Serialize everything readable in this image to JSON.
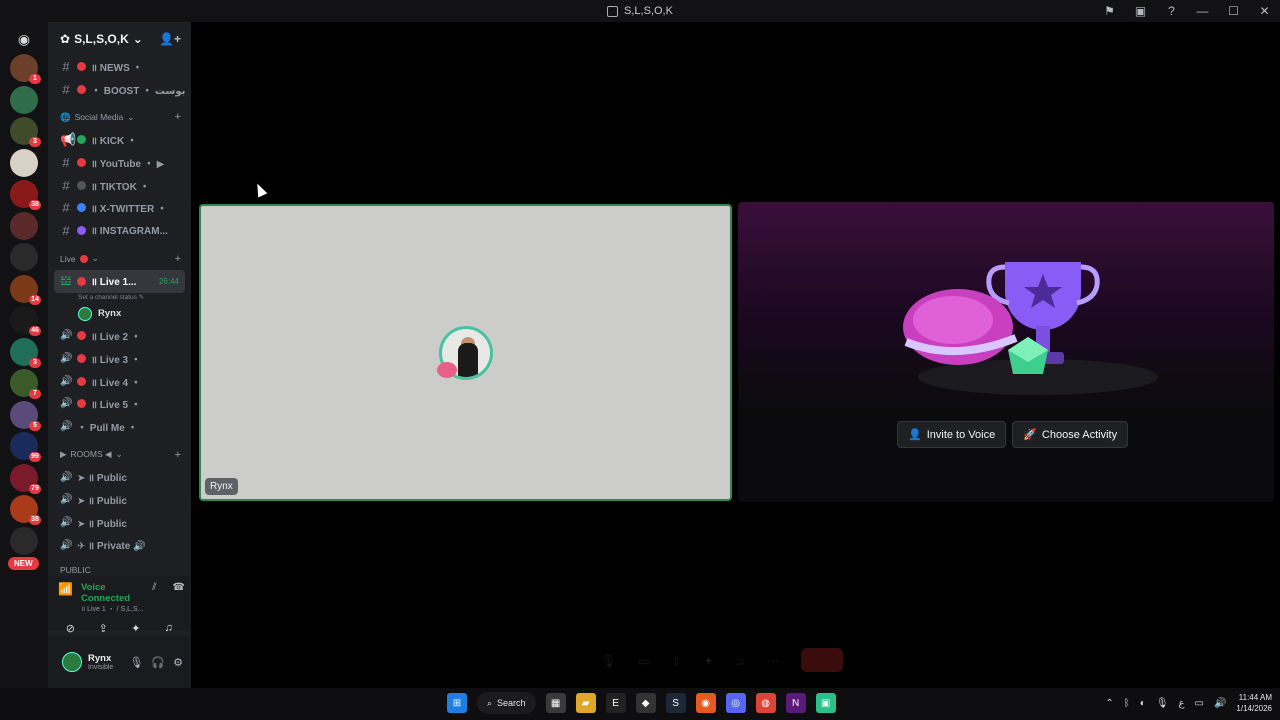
{
  "window": {
    "title": "S,L,S,O,K"
  },
  "guild": {
    "name": "S,L,S,O,K"
  },
  "channels": [
    {
      "prefix": "#",
      "dot": "#e63a42",
      "label": "॥ NEWS ・",
      "type": "text"
    },
    {
      "prefix": "#",
      "dot": "#e63a42",
      "label": "・ BOOST ・ بوست",
      "type": "text"
    }
  ],
  "social_category": {
    "label": "Social Media"
  },
  "social_channels": [
    {
      "prefix": "📢",
      "dot": "#23a55a",
      "label": "॥ KICK ・",
      "type": "announce"
    },
    {
      "prefix": "#",
      "dot": "#e63a42",
      "label": "॥ YouTube ・ ▶",
      "type": "text"
    },
    {
      "prefix": "#",
      "dot": "#555555",
      "label": "॥ TIKTOK ・",
      "type": "text"
    },
    {
      "prefix": "#",
      "dot": "#3b82f6",
      "label": "॥ X-TWITTER ・",
      "type": "text"
    },
    {
      "prefix": "#",
      "dot": "#8b5cf6",
      "label": "॥ INSTAGRAM...",
      "type": "text"
    }
  ],
  "live_category": {
    "label": "Live"
  },
  "live_active": {
    "label": "॥ Live 1...",
    "time": "26:44",
    "status": "Set a channel status"
  },
  "live_member": {
    "name": "Rynx"
  },
  "live_channels": [
    {
      "label": "॥ Live 2 ・"
    },
    {
      "label": "॥ Live 3 ・"
    },
    {
      "label": "॥ Live 4 ・"
    },
    {
      "label": "॥ Live 5 ・"
    },
    {
      "label": "・ Pull Me ・"
    }
  ],
  "rooms_category": {
    "label": "ROOMS ◀"
  },
  "rooms_channels": [
    {
      "label": "➤ ॥ Public"
    },
    {
      "label": "➤ ॥ Public"
    },
    {
      "label": "➤ ॥ Public"
    },
    {
      "label": "✈ ॥ Private 🔊"
    }
  ],
  "public_category": {
    "label": "PUBLIC"
  },
  "servers": [
    {
      "color": "#6b3f2a",
      "badge": "1"
    },
    {
      "color": "#2f6d4a",
      "badge": ""
    },
    {
      "color": "#3f4b2a",
      "badge": "3"
    },
    {
      "color": "#d8d2c6",
      "badge": ""
    },
    {
      "color": "#8a1a1a",
      "badge": "38"
    },
    {
      "color": "#5a2a2a",
      "badge": ""
    },
    {
      "color": "#2a2a2a",
      "badge": ""
    },
    {
      "color": "#7a3a1a",
      "badge": "14"
    },
    {
      "color": "#1a1a1a",
      "badge": "46"
    },
    {
      "color": "#1f6e5a",
      "badge": "3"
    },
    {
      "color": "#3a5a2a",
      "badge": "7"
    },
    {
      "color": "#5a4a7a",
      "badge": "5"
    },
    {
      "color": "#1a2a5a",
      "badge": "99"
    },
    {
      "color": "#7a1a2a",
      "badge": "79"
    },
    {
      "color": "#aa3a1a",
      "badge": "38"
    },
    {
      "color": "#2a2a2a",
      "badge": ""
    }
  ],
  "new_badge": "NEW",
  "voice": {
    "status": "Voice Connected",
    "location": "॥ Live 1 ・ / S,L,S..."
  },
  "user": {
    "name": "Rynx",
    "status": "Invisible"
  },
  "stage": {
    "tile_name": "Rynx",
    "invite_label": "Invite to Voice",
    "activity_label": "Choose Activity"
  },
  "taskbar": {
    "search_label": "Search",
    "time": "11:44 AM",
    "date": "1/14/2026"
  }
}
